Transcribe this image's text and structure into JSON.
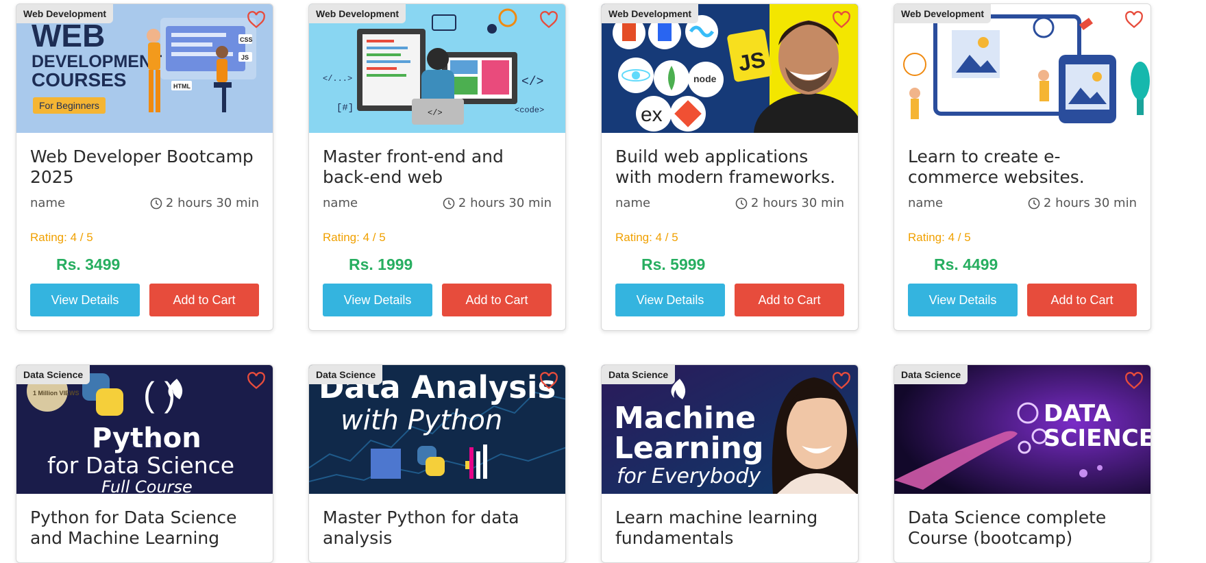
{
  "colors": {
    "accent_blue": "#34b4df",
    "cart_red": "#e74c3c",
    "price_green": "#27ae60",
    "rating_orange": "#f0a000",
    "heart_red": "#e74c3c"
  },
  "cards": [
    {
      "category": "Web Development",
      "title": "Web Developer Bootcamp 2025",
      "instructor": "name",
      "duration": "2 hours 30 min",
      "rating": "Rating: 4 / 5",
      "price": "Rs. 3499",
      "view_label": "View Details",
      "cart_label": "Add to Cart",
      "thumb_text": [
        "WEB",
        "DEVELOPMENT",
        "COURSES",
        "For Beginners",
        "HTML",
        "CSS",
        "JS"
      ]
    },
    {
      "category": "Web Development",
      "title": "Master front-end and back-end web technologies.",
      "instructor": "name",
      "duration": "2 hours 30 min",
      "rating": "Rating: 4 / 5",
      "price": "Rs. 1999",
      "view_label": "View Details",
      "cart_label": "Add to Cart",
      "thumb_text": [
        "</>",
        "</...>",
        "[#]",
        "<code>",
        "</>"
      ]
    },
    {
      "category": "Web Development",
      "title": "Build web applications with modern frameworks.",
      "instructor": "name",
      "duration": "2 hours 30 min",
      "rating": "Rating: 4 / 5",
      "price": "Rs. 5999",
      "view_label": "View Details",
      "cart_label": "Add to Cart",
      "thumb_text": [
        "JS",
        "ex",
        "node"
      ]
    },
    {
      "category": "Web Development",
      "title": "Learn to create e-commerce websites.",
      "instructor": "name",
      "duration": "2 hours 30 min",
      "rating": "Rating: 4 / 5",
      "price": "Rs. 4499",
      "view_label": "View Details",
      "cart_label": "Add to Cart",
      "thumb_text": []
    },
    {
      "category": "Data Science",
      "title": "Python for Data Science and Machine Learning",
      "instructor": "",
      "duration": "",
      "rating": "",
      "price": "",
      "view_label": "",
      "cart_label": "",
      "thumb_text": [
        "Python",
        "for Data Science",
        "Full Course",
        "1 Million VIEWS",
        "( )"
      ]
    },
    {
      "category": "Data Science",
      "title": "Master Python for data analysis",
      "instructor": "",
      "duration": "",
      "rating": "",
      "price": "",
      "view_label": "",
      "cart_label": "",
      "thumb_text": [
        "Data Analysis",
        "with Python"
      ]
    },
    {
      "category": "Data Science",
      "title": "Learn machine learning fundamentals",
      "instructor": "",
      "duration": "",
      "rating": "",
      "price": "",
      "view_label": "",
      "cart_label": "",
      "thumb_text": [
        "Machine",
        "Learning",
        "for Everybody"
      ]
    },
    {
      "category": "Data Science",
      "title": "Data Science complete Course (bootcamp)",
      "instructor": "",
      "duration": "",
      "rating": "",
      "price": "",
      "view_label": "",
      "cart_label": "",
      "thumb_text": [
        "DATA",
        "SCIENCE"
      ]
    }
  ]
}
